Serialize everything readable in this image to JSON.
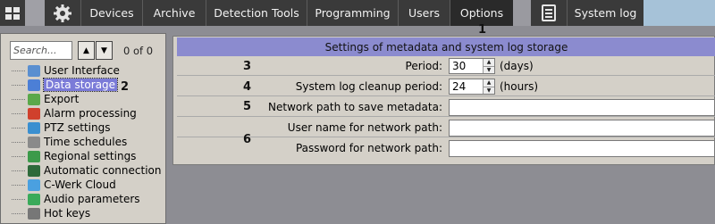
{
  "toolbar": {
    "tabs": [
      "Devices",
      "Archive",
      "Detection Tools",
      "Programming",
      "Users",
      "Options"
    ],
    "system_log": "System log",
    "active_tab": "Options"
  },
  "markers": {
    "m1": "1",
    "m2": "2",
    "m3": "3",
    "m4": "4",
    "m5": "5",
    "m6": "6"
  },
  "search": {
    "placeholder": "Search...",
    "counter": "0 of 0"
  },
  "tree": [
    {
      "label": "User Interface",
      "icon": "user-interface-icon",
      "color": "#5a8fd0"
    },
    {
      "label": "Data storage",
      "icon": "data-storage-icon",
      "color": "#4c7fd6",
      "selected": true
    },
    {
      "label": "Export",
      "icon": "export-icon",
      "color": "#5aa84a"
    },
    {
      "label": "Alarm processing",
      "icon": "alarm-icon",
      "color": "#d0402c"
    },
    {
      "label": "PTZ settings",
      "icon": "ptz-icon",
      "color": "#3a8fd0"
    },
    {
      "label": "Time schedules",
      "icon": "clock-icon",
      "color": "#8a8a8a"
    },
    {
      "label": "Regional settings",
      "icon": "globe-icon",
      "color": "#3c9a4a"
    },
    {
      "label": "Automatic connection",
      "icon": "connection-icon",
      "color": "#2d6a3a"
    },
    {
      "label": "C-Werk Cloud",
      "icon": "cloud-icon",
      "color": "#4aa0e0"
    },
    {
      "label": "Audio parameters",
      "icon": "audio-icon",
      "color": "#3aaa5a"
    },
    {
      "label": "Hot keys",
      "icon": "keyboard-icon",
      "color": "#777777"
    }
  ],
  "settings": {
    "title": "Settings of metadata and system log storage",
    "period_label": "Period:",
    "period_value": "30",
    "period_unit": "(days)",
    "cleanup_label": "System log cleanup period:",
    "cleanup_value": "24",
    "cleanup_unit": "(hours)",
    "path_label": "Network path to save metadata:",
    "user_label": "User name for network path:",
    "password_label": "Password for network path:"
  }
}
